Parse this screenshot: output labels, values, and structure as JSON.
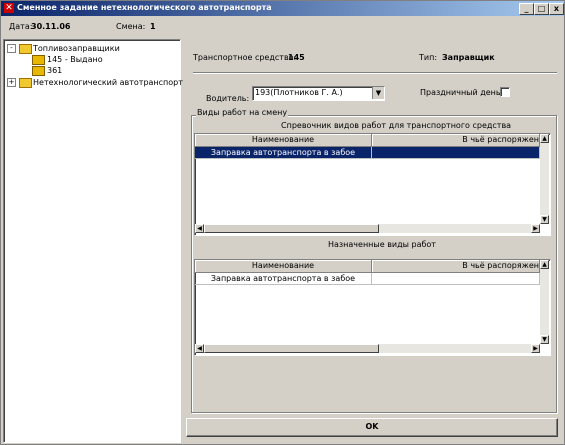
{
  "window": {
    "title": "Сменное задание нетехнологического автотранспорта"
  },
  "info": {
    "date_label": "Дата:",
    "date_value": "30.11.06",
    "shift_label": "Смена:",
    "shift_value": "1"
  },
  "tree": {
    "items": [
      {
        "label": "Топливозаправщики",
        "expander": "-"
      },
      {
        "label": "145 - Выдано"
      },
      {
        "label": "361"
      },
      {
        "label": "Нетехнологический автотранспорт",
        "expander": "+"
      }
    ]
  },
  "details": {
    "vehicle_label": "Транспортное средство:",
    "vehicle_value": "145",
    "type_label": "Тип:",
    "type_value": "Заправщик",
    "driver_label": "Водитель:",
    "driver_value": "193(Плотников Г. А.)",
    "holiday_label": "Праздничный день:"
  },
  "work_types": {
    "group_label": "Виды работ на смену",
    "reference_title": "Спревочник видов работ для транспортного средства",
    "assigned_title": "Назначенные виды работ",
    "columns": [
      "Наименование",
      "В чьё распоряжен"
    ],
    "reference_rows": [
      [
        "Заправка автотранспорта в забое",
        ""
      ]
    ],
    "assigned_rows": [
      [
        "Заправка автотранспорта в забое",
        ""
      ]
    ]
  },
  "buttons": {
    "ok": "OK",
    "minimize": "_",
    "maximize": "□",
    "close": "x"
  },
  "colors": {
    "titlebar": "#0a246a",
    "selection": "#0a246a",
    "face": "#d4d0c8"
  }
}
